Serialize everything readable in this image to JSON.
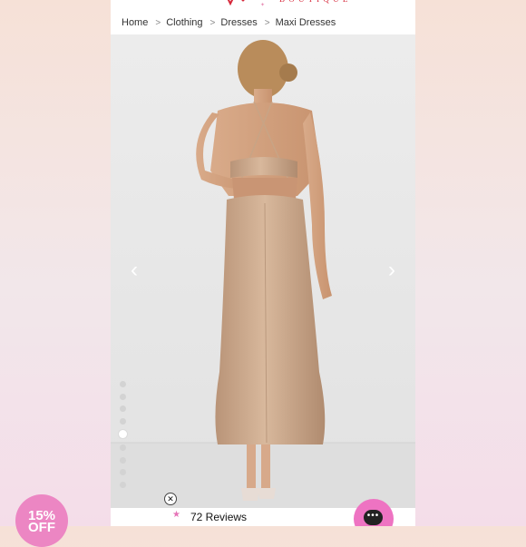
{
  "breadcrumb": {
    "items": [
      "Home",
      "Clothing",
      "Dresses",
      "Maxi Dresses"
    ],
    "separator": ">"
  },
  "gallery": {
    "prev_icon": "chevron-left-icon",
    "next_icon": "chevron-right-icon",
    "prev_glyph": "‹",
    "next_glyph": "›",
    "image_count": 10,
    "active_index": 4
  },
  "reviews": {
    "label": "72 Reviews"
  },
  "promo": {
    "line1": "15%",
    "line2": "OFF",
    "close_glyph": "✕",
    "star_glyph": "★"
  },
  "chat": {
    "icon": "chat-bubble-icon",
    "glyph": "•••"
  },
  "colors": {
    "accent_pink": "#ec86c3",
    "logo_red": "#d6283a",
    "dress": "#c9a588"
  }
}
